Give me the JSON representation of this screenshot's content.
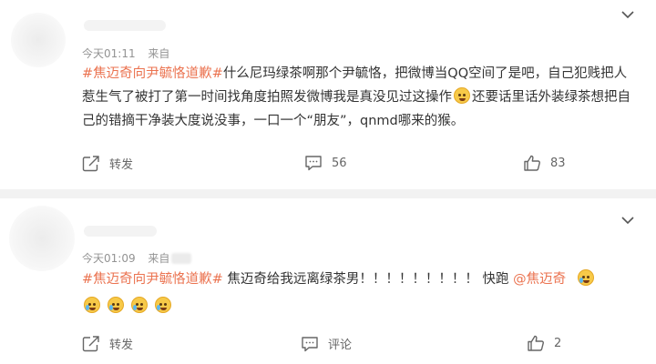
{
  "posts": [
    {
      "time": "今天01:11",
      "source_label": "来自",
      "hashtag": "#焦迈奇向尹毓恪道歉#",
      "text_part1": "什么尼玛绿茶啊那个尹毓恪，把微博当QQ空间了是吧，自己犯贱把人惹生气了被打了第一时间找角度拍照发微博我是真没见过这操作",
      "text_part2": "还要话里话外装绿茶想把自己的错摘干净装大度说没事，一口一个“朋友”，qnmd哪来的猴。",
      "emoji_inline": "thinking-emoji",
      "actions": {
        "share": "转发",
        "comment": "56",
        "like": "83"
      }
    },
    {
      "time": "今天01:09",
      "source_label": "来自",
      "hashtag": "#焦迈奇向尹毓恪道歉#",
      "text": " 焦迈奇给我远离绿茶男！！！！！！！！！ 快跑 ",
      "mention": "@焦迈奇",
      "emoji_trailing": "crying-emoji",
      "emoji_row": [
        "crying-emoji",
        "crying-emoji",
        "crying-emoji",
        "crying-emoji"
      ],
      "actions": {
        "share": "转发",
        "comment": "评论",
        "like": "2"
      }
    }
  ],
  "colors": {
    "accent": "#eb7350",
    "meta": "#939393",
    "separator": "#f2f2f2"
  }
}
